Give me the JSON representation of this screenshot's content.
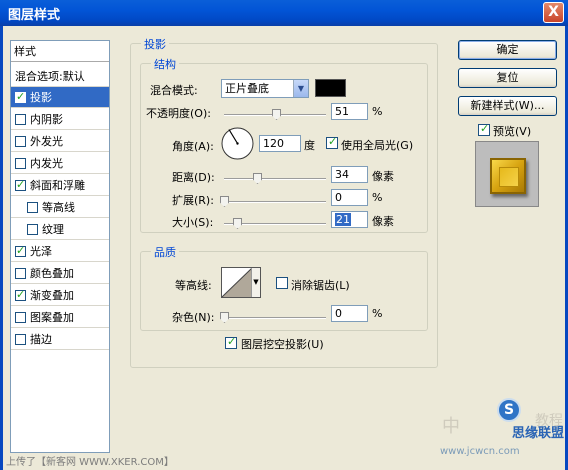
{
  "window": {
    "title": "图层样式",
    "close": "X"
  },
  "stylelist": {
    "header": "样式",
    "blend_options": "混合选项:默认",
    "items": [
      {
        "label": "投影",
        "checked": true,
        "selected": true,
        "sub": false
      },
      {
        "label": "内阴影",
        "checked": false,
        "selected": false,
        "sub": false
      },
      {
        "label": "外发光",
        "checked": false,
        "selected": false,
        "sub": false
      },
      {
        "label": "内发光",
        "checked": false,
        "selected": false,
        "sub": false
      },
      {
        "label": "斜面和浮雕",
        "checked": true,
        "selected": false,
        "sub": false
      },
      {
        "label": "等高线",
        "checked": false,
        "selected": false,
        "sub": true
      },
      {
        "label": "纹理",
        "checked": false,
        "selected": false,
        "sub": true
      },
      {
        "label": "光泽",
        "checked": true,
        "selected": false,
        "sub": false
      },
      {
        "label": "颜色叠加",
        "checked": false,
        "selected": false,
        "sub": false
      },
      {
        "label": "渐变叠加",
        "checked": true,
        "selected": false,
        "sub": false
      },
      {
        "label": "图案叠加",
        "checked": false,
        "selected": false,
        "sub": false
      },
      {
        "label": "描边",
        "checked": false,
        "selected": false,
        "sub": false
      }
    ]
  },
  "shadow": {
    "group_title": "投影",
    "structure": {
      "title": "结构",
      "blend_mode_label": "混合模式:",
      "blend_mode_value": "正片叠底",
      "opacity_label": "不透明度(O):",
      "opacity_value": "51",
      "opacity_fraction": 0.51,
      "percent": "%",
      "angle_label": "角度(A):",
      "angle_value": "120",
      "angle_unit": "度",
      "global_light_label": "使用全局光(G)",
      "global_light_checked": true,
      "distance_label": "距离(D):",
      "distance_value": "34",
      "spread_label": "扩展(R):",
      "spread_value": "0",
      "size_label": "大小(S):",
      "size_value": "21",
      "pixels": "像素"
    },
    "quality": {
      "title": "品质",
      "contour_label": "等高线:",
      "antialias_label": "消除锯齿(L)",
      "antialias_checked": false,
      "noise_label": "杂色(N):",
      "noise_value": "0",
      "percent": "%"
    },
    "knockout_label": "图层挖空投影(U)",
    "knockout_checked": true
  },
  "buttons": {
    "ok": "确定",
    "reset": "复位",
    "new_style": "新建样式(W)...",
    "preview_label": "预览(V)",
    "preview_checked": true
  },
  "watermark": {
    "bottom_left": "上传了【新客网 WWW.XKER.COM】",
    "site": "www.jcwcn.com",
    "cn_left": "中",
    "cn_right": "教程",
    "logo_text": "S",
    "brand": "思缘联盟"
  }
}
